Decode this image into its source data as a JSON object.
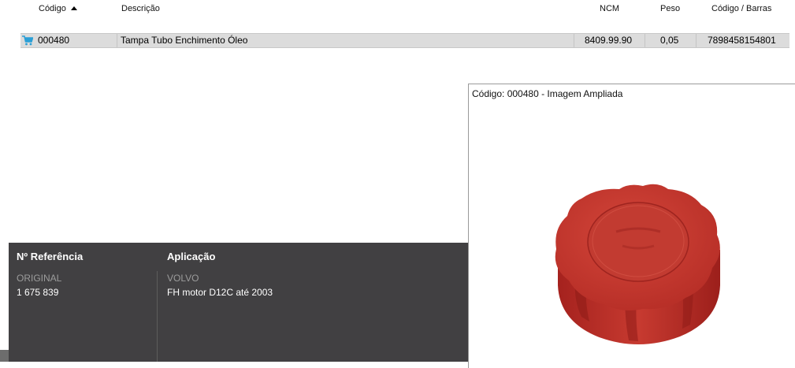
{
  "table": {
    "headers": {
      "codigo": "Código",
      "descricao": "Descrição",
      "ncm": "NCM",
      "peso": "Peso",
      "barras": "Código / Barras"
    },
    "rows": [
      {
        "icon": "cart-icon",
        "codigo": "000480",
        "descricao": "Tampa Tubo Enchimento Óleo",
        "ncm": "8409.99.90",
        "peso": "0,05",
        "barras": "7898458154801"
      }
    ]
  },
  "details": {
    "referencia_title": "Nº Referência",
    "aplicacao_title": "Aplicação",
    "referencia_category": "ORIGINAL",
    "referencia_value": "1 675 839",
    "aplicacao_category": "VOLVO",
    "aplicacao_value": "FH motor D12C até 2003"
  },
  "popup": {
    "title": "Código: 000480 - Imagem Ampliada",
    "image": "red-oil-filler-cap"
  },
  "colors": {
    "row_selected": "#dcdcdc",
    "dark_panel": "#414042",
    "cart_icon": "#2a9fd6",
    "cap_red": "#c4302b"
  }
}
